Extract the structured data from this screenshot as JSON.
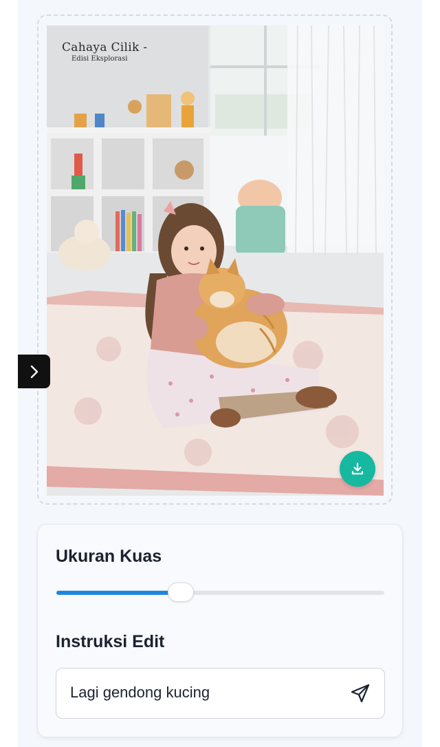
{
  "image": {
    "watermark_title": "Cahaya Cilik -",
    "watermark_subtitle": "Edisi Eksplorasi",
    "download_icon": "download-icon"
  },
  "sidebar_toggle": {
    "icon": "chevron-right-icon"
  },
  "brush": {
    "title": "Ukuran Kuas",
    "value_fraction": 0.38
  },
  "edit": {
    "title": "Instruksi Edit",
    "input_value": "Lagi gendong kucing",
    "send_icon": "send-icon"
  },
  "colors": {
    "accent": "#1f86e0",
    "download": "#16b8a0",
    "toggle": "#111111"
  }
}
